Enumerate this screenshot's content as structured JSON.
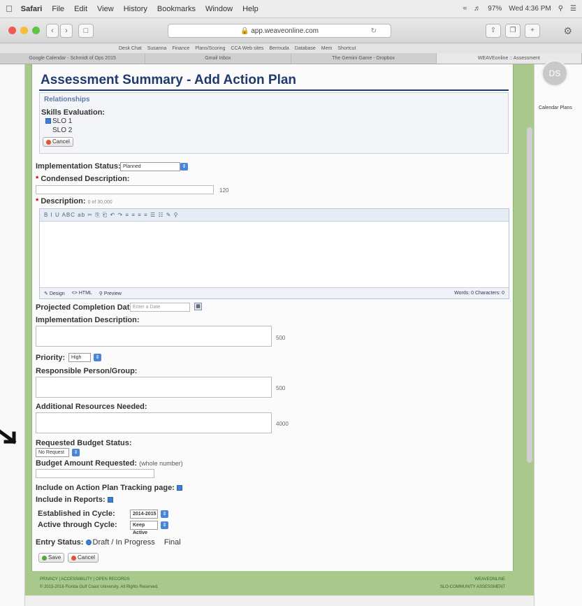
{
  "menubar": {
    "app": "Safari",
    "items": [
      "File",
      "Edit",
      "View",
      "History",
      "Bookmarks",
      "Window",
      "Help"
    ],
    "battery": "97%",
    "clock": "Wed 4:36 PM"
  },
  "browser": {
    "url": "app.weaveonline.com",
    "bookmarks": [
      "Desk Chat",
      "Susanna",
      "Finance",
      "Plans/Scoring",
      "CCA Web sites",
      "Bermuda",
      "Database",
      "Mem",
      "Shortcut"
    ],
    "tabs": [
      "Google Calendar - Schmidt of Ops 2015",
      "Gmail Inbox",
      "The Gemini Game - Dropbox",
      "WEAVEonline :: Assessment"
    ]
  },
  "page": {
    "title": "Assessment Summary - Add Action Plan",
    "relationships_legend": "Relationships",
    "skills_label": "Skills Evaluation:",
    "slo1": "SLO 1",
    "slo2": "SLO 2",
    "cancel_small": "Cancel",
    "impl_status_label": "Implementation Status:",
    "impl_status_value": "Planned",
    "condensed_label": "Condensed Description:",
    "condensed_count": "120",
    "description_label": "Description:",
    "description_hint": "0 of 30,000",
    "editor_toolbar": "B I U  ABC ab  ✂ ⎘ ⎗  ↶ ↷  ≡ ≡ ≡ ≡  ☰ ☷  ✎ ⚲",
    "editor_design": "Design",
    "editor_html": "HTML",
    "editor_preview": "Preview",
    "editor_counts": "Words: 0  Characters: 0",
    "projected_label": "Projected Completion Date:",
    "projected_placeholder": "Enter a Date",
    "impl_desc_label": "Implementation Description:",
    "impl_desc_count": "500",
    "priority_label": "Priority:",
    "priority_value": "High",
    "responsible_label": "Responsible Person/Group:",
    "responsible_count": "500",
    "additional_label": "Additional Resources Needed:",
    "additional_count": "4000",
    "budget_status_label": "Requested Budget Status:",
    "budget_status_value": "No Request",
    "budget_amount_label": "Budget Amount Requested:",
    "budget_amount_hint": "(whole number)",
    "tracking_label": "Include on Action Plan Tracking page:",
    "reports_label": "Include in Reports:",
    "established_label": "Established in Cycle:",
    "established_value": "2014-2015",
    "active_label": "Active through Cycle:",
    "active_value": "Keep Active",
    "entry_status_label": "Entry Status:",
    "entry_draft": "Draft / In Progress",
    "entry_final": "Final",
    "save_label": "Save",
    "cancel_label": "Cancel"
  },
  "footer": {
    "left_line1": "PRIVACY | ACCESSIBILITY | OPEN RECORDS",
    "left_line2": "© 2015-2016 Florida Gulf Coast University. All Rights Reserved.",
    "right_line1": "WEAVEONLINE",
    "right_line2": "SLO-COMMUNITY ASSESSMENT"
  },
  "side": {
    "avatar": "DS",
    "text": "Calendar Plans"
  }
}
